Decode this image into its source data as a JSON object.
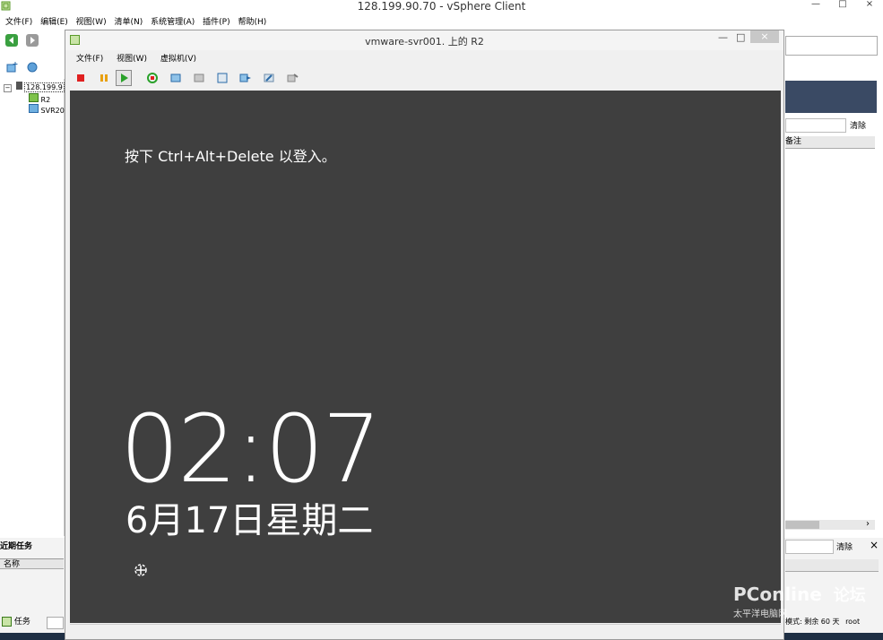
{
  "app": {
    "title": "128.199.90.70 - vSphere Client",
    "window_controls": [
      "—",
      "□",
      "×"
    ]
  },
  "main_menu": [
    "文件(F)",
    "编辑(E)",
    "视图(W)",
    "清单(N)",
    "系统管理(A)",
    "插件(P)",
    "帮助(H)"
  ],
  "inventory": {
    "host": "128.199.9",
    "vms": [
      "R2",
      "SVR20"
    ]
  },
  "right_panel": {
    "clear_label": "清除",
    "column_notes": "备注"
  },
  "recent_tasks": {
    "title": "近期任务",
    "column_name": "名称",
    "clear_label": "清除",
    "close_glyph": "×"
  },
  "taskbar": {
    "tasks_tab": "任务"
  },
  "status": {
    "eval": "模式: 剩余 60 天",
    "user": "root"
  },
  "vm_console": {
    "title": "vmware-svr001. 上的 R2",
    "controls": [
      "—",
      "□",
      "×"
    ],
    "menu": [
      "文件(F)",
      "视图(W)",
      "虚拟机(V)"
    ],
    "toolbar_icons": [
      "stop-icon",
      "pause-icon",
      "play-icon",
      "reset-icon",
      "snapshot-take-icon",
      "snapshot-revert-icon",
      "snapshot-manager-icon",
      "console-send-icon",
      "vm-settings-icon",
      "cd-connect-icon"
    ]
  },
  "lock_screen": {
    "prompt": "按下 Ctrl+Alt+Delete 以登入。",
    "time": "02:07",
    "date": "6月17日星期二"
  },
  "watermark": {
    "brand": "PConline",
    "sub": "太平洋电脑网",
    "forum": "论坛"
  },
  "colors": {
    "console_bg": "#3f3f3f",
    "stop": "#e02020",
    "pause": "#e8a010",
    "play": "#2aa12a",
    "header_navy": "#3a4a64"
  }
}
